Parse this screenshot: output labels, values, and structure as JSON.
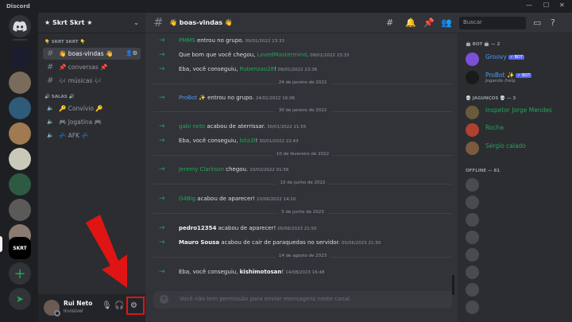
{
  "window": {
    "title": "Discord"
  },
  "guild": {
    "name": "★ Skrt Skrt ★"
  },
  "categories": {
    "skrt": "👇 SKRT SKRT 👇",
    "salas": "🔊 SALAS 🔊"
  },
  "channels": [
    {
      "label": "👋 boas-vindas 👋",
      "selected": true
    },
    {
      "label": "📌 conversas 📌"
    },
    {
      "label": "🎶 músicas 🎶"
    }
  ],
  "voice_channels": [
    {
      "label": "🔑 Convívio 🔑"
    },
    {
      "label": "🎮 Jogatina 🎮"
    },
    {
      "label": "💤 AFK 💤"
    }
  ],
  "user": {
    "name": "Rui Neto",
    "status": "Invisível"
  },
  "header": {
    "channel_title": "👋 boas-vindas 👋",
    "search_placeholder": "Buscar"
  },
  "messages": [
    {
      "type": "msg",
      "user": "PMMS",
      "user_color": "green",
      "text": " entrou no grupo.",
      "time": "09/01/2022 23:33",
      "prefix": ""
    },
    {
      "type": "msg",
      "prefix": "Que bom que você chegou, ",
      "user": "LovedMastermind",
      "user_color": "green",
      "text": ".",
      "time": "09/01/2022 23:33"
    },
    {
      "type": "msg",
      "prefix": "Eba, você conseguiu, ",
      "user": "Rubenzao28",
      "user_color": "green",
      "text": "!",
      "time": "09/01/2022 23:36"
    },
    {
      "type": "divider",
      "label": "24 de janeiro de 2022"
    },
    {
      "type": "msg",
      "prefix": "",
      "user": "ProBot ✨",
      "user_color": "blue",
      "text": " entrou no grupo.",
      "time": "24/01/2022 16:36"
    },
    {
      "type": "divider",
      "label": "30 de janeiro de 2022"
    },
    {
      "type": "msg",
      "prefix": "",
      "user": "gabi neto",
      "user_color": "green",
      "text": " acabou de aterrissar.",
      "time": "30/01/2022 21:55"
    },
    {
      "type": "msg",
      "prefix": "Eba, você conseguiu, ",
      "user": "bita3l",
      "user_color": "green",
      "text": "!",
      "time": "30/01/2022 22:43"
    },
    {
      "type": "divider",
      "label": "10 de fevereiro de 2022"
    },
    {
      "type": "msg",
      "prefix": "",
      "user": "Jeremy Clarkson",
      "user_color": "green",
      "text": " chegou.",
      "time": "10/02/2022 01:56"
    },
    {
      "type": "divider",
      "label": "10 de junho de 2022"
    },
    {
      "type": "msg",
      "prefix": "",
      "user": "G4Big",
      "user_color": "green",
      "text": " acabou de aparecer!",
      "time": "10/06/2022 14:10"
    },
    {
      "type": "divider",
      "label": "5 de junho de 2023"
    },
    {
      "type": "msg",
      "prefix": "",
      "user": "pedro12354",
      "user_color": "white",
      "text": " acabou de aparecer!",
      "time": "05/06/2023 21:50"
    },
    {
      "type": "msg",
      "prefix": "",
      "user": "Mauro Sousa",
      "user_color": "white",
      "text": " acabou de cair de paraquedas no servidor.",
      "time": "05/06/2023 21:50"
    },
    {
      "type": "divider",
      "label": "14 de agosto de 2023"
    },
    {
      "type": "msg",
      "prefix": "Eba, você conseguiu, ",
      "user": "kishimotosan",
      "user_color": "white",
      "text": "!",
      "time": "14/08/2023 16:48"
    }
  ],
  "composer": {
    "placeholder": "Você não tem permissão para enviar mensagens neste canal."
  },
  "member_groups": {
    "bot": {
      "label": "🤖 BOT 🤖 — 2"
    },
    "jaguncos": {
      "label": "💀 JAGUNÇOS 💀 — 3"
    },
    "offline": {
      "label": "OFFLINE — 81"
    }
  },
  "members_bot": [
    {
      "name": "Groovy",
      "color": "#4f9cf0",
      "tag": "✓ BOT",
      "sub": ""
    },
    {
      "name": "ProBot ✨",
      "color": "#4f9cf0",
      "tag": "✓ BOT",
      "sub": "Jogando /help"
    }
  ],
  "members_jaguncos": [
    {
      "name": "Inspetor Jorge Mendes",
      "color": "#23a55a"
    },
    {
      "name": "Rocha",
      "color": "#23a55a"
    },
    {
      "name": "Sérgio calado",
      "color": "#23a55a"
    }
  ],
  "members_offline_count_shown": 8,
  "colors": {
    "accent": "#5865f2",
    "green": "#23a55a",
    "blue": "#4f9cf0",
    "annotation_red": "#e01414"
  }
}
